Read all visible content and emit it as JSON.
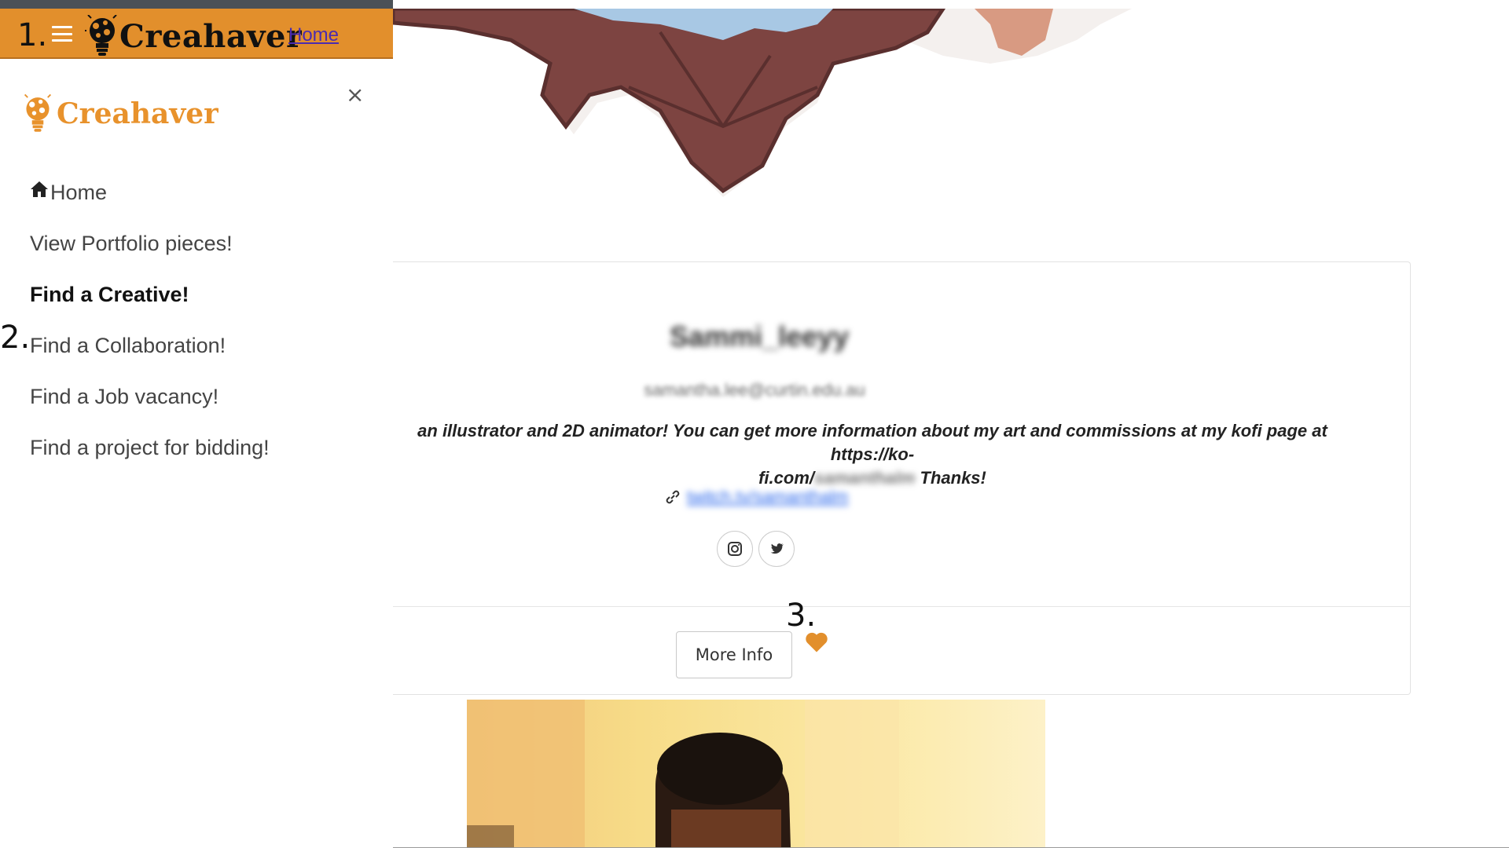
{
  "header": {
    "step_label": "1.",
    "brand": "Creahaver",
    "home_link": "Home"
  },
  "sidebar": {
    "brand": "Creahaver",
    "close": "×",
    "step_label": "2.",
    "items": [
      {
        "label": "Home"
      },
      {
        "label": "View Portfolio pieces!"
      },
      {
        "label": "Find a Creative!"
      },
      {
        "label": "Find a Collaboration!"
      },
      {
        "label": "Find a Job vacancy!"
      },
      {
        "label": "Find a project for bidding!"
      }
    ]
  },
  "profile": {
    "username": "Sammi_leeyy",
    "email": "samantha.lee@curtin.edu.au",
    "bio_line1": "an illustrator and 2D animator! You can get more information about my art and commissions at my kofi page at https://ko-",
    "bio_line2_start": "fi.com/",
    "bio_line2_blurred": "samanthalm",
    "bio_line2_end": " Thanks!",
    "link": "twitch.tv/samanthalm",
    "more_info": "More Info",
    "step_label": "3."
  },
  "colors": {
    "header_bg": "#e28f2c",
    "brand_orange": "#e8922c",
    "link_purple": "#4b2bb0",
    "heart": "#e28f2c"
  },
  "icons": [
    "hamburger-icon",
    "lightbulb-logo-icon",
    "close-icon",
    "home-icon",
    "link-icon",
    "instagram-icon",
    "twitter-icon",
    "heart-icon"
  ]
}
